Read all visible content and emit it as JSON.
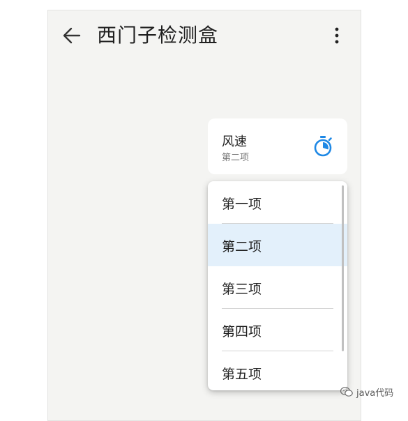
{
  "app_bar": {
    "title": "西门子检测盒",
    "back_icon": "arrow-left-icon",
    "more_icon": "more-vertical-icon"
  },
  "speed_card": {
    "title": "风速",
    "subtitle": "第二项",
    "icon": "stopwatch-icon",
    "icon_color": "#1e88e5"
  },
  "dropdown": {
    "options": [
      "第一项",
      "第二项",
      "第三项",
      "第四项",
      "第五项"
    ],
    "selected_index": 1,
    "selected_bg": "#e3f0fb"
  },
  "watermark": {
    "text": "java代码",
    "icon": "wechat-icon"
  }
}
